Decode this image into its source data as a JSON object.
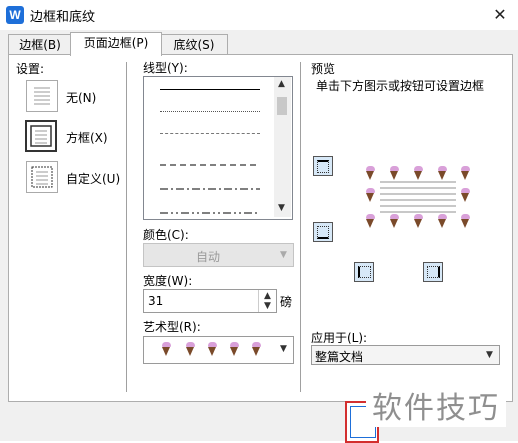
{
  "window": {
    "title": "边框和底纹",
    "close_glyph": "✕",
    "app_icon_glyph": "W"
  },
  "tabs": [
    {
      "label": "边框(B)",
      "active": false
    },
    {
      "label": "页面边框(P)",
      "active": true
    },
    {
      "label": "底纹(S)",
      "active": false
    }
  ],
  "settings": {
    "label": "设置:",
    "items": [
      {
        "label": "无(N)",
        "selected": false
      },
      {
        "label": "方框(X)",
        "selected": true
      },
      {
        "label": "自定义(U)",
        "selected": false
      }
    ]
  },
  "line_style": {
    "label": "线型(Y):",
    "styles": [
      "solid",
      "dotted",
      "dashed-fine",
      "dashed",
      "dash-dot",
      "dash-dot-dot"
    ]
  },
  "color": {
    "label": "颜色(C):",
    "value": "自动"
  },
  "width": {
    "label": "宽度(W):",
    "value": "31",
    "unit": "磅"
  },
  "art": {
    "label": "艺术型(R):"
  },
  "preview": {
    "label": "预览",
    "hint": "单击下方图示或按钮可设置边框"
  },
  "apply_to": {
    "label": "应用于(L):",
    "value": "整篇文档"
  },
  "watermark": "软件技巧",
  "colors": {
    "cone_top": "#d9a0d9",
    "cone_body": "#7a4a2a",
    "accent": "#1e6fd9"
  }
}
